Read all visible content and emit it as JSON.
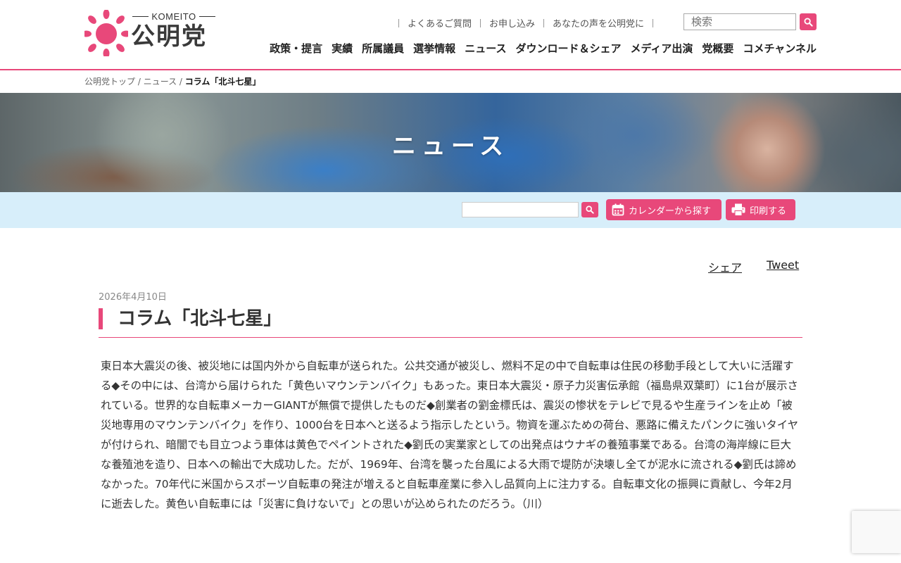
{
  "header": {
    "logo_en": "KOMEITO",
    "logo_jp": "公明党",
    "util_links": [
      "よくあるご質問",
      "お申し込み",
      "あなたの声を公明党に"
    ],
    "search_placeholder": "検索",
    "main_nav": [
      "政策・提言",
      "実績",
      "所属議員",
      "選挙情報",
      "ニュース",
      "ダウンロード＆シェア",
      "メディア出演",
      "党概要",
      "コメチャンネル"
    ]
  },
  "breadcrumb": {
    "home": "公明党トップ",
    "section": "ニュース",
    "current": "コラム「北斗七星」",
    "separator": " / "
  },
  "hero": {
    "title": "ニュース"
  },
  "toolbar": {
    "calendar_label": "カレンダーから探す",
    "print_label": "印刷する"
  },
  "share": {
    "facebook": "シェア",
    "twitter": "Tweet"
  },
  "article": {
    "date": "2026年4月10日",
    "title": "コラム「北斗七星」",
    "body": "東日本大震災の後、被災地には国内外から自転車が送られた。公共交通が被災し、燃料不足の中で自転車は住民の移動手段として大いに活躍する◆その中には、台湾から届けられた「黄色いマウンテンバイク」もあった。東日本大震災・原子力災害伝承館（福島県双葉町）に1台が展示されている。世界的な自転車メーカーGIANTが無償で提供したものだ◆創業者の劉金標氏は、震災の惨状をテレビで見るや生産ラインを止め「被災地専用のマウンテンバイク」を作り、1000台を日本へと送るよう指示したという。物資を運ぶための荷台、悪路に備えたパンクに強いタイヤが付けられ、暗闇でも目立つよう車体は黄色でペイントされた◆劉氏の実業家としての出発点はウナギの養殖事業である。台湾の海岸線に巨大な養殖池を造り、日本への輸出で大成功した。だが、1969年、台湾を襲った台風による大雨で堤防が決壊し全てが泥水に流される◆劉氏は諦めなかった。70年代に米国からスポーツ自転車の発注が増えると自転車産業に参入し品質向上に注力する。自転車文化の振興に貢献し、今年2月に逝去した。黄色い自転車には「災害に負けないで」との思いが込められたのだろう。（川）"
  },
  "colors": {
    "accent": "#e8487a",
    "toolbar_bg": "#d7eefa"
  }
}
